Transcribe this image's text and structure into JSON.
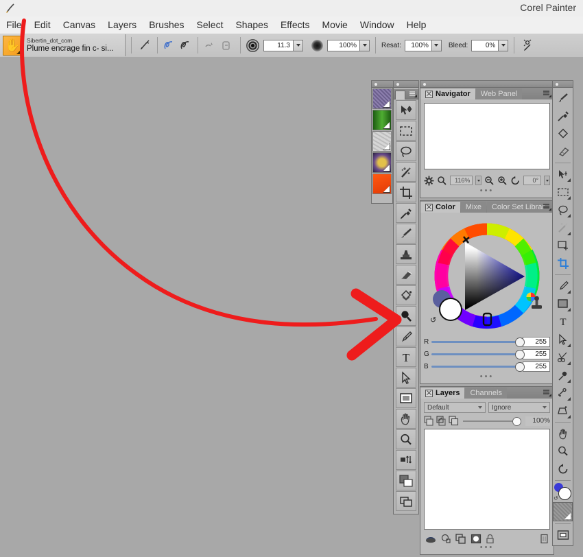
{
  "window": {
    "app_title": "Corel Painter",
    "title_icon": "brush-icon"
  },
  "menubar": {
    "items": [
      {
        "label": "File"
      },
      {
        "label": "Edit"
      },
      {
        "label": "Canvas"
      },
      {
        "label": "Layers"
      },
      {
        "label": "Brushes"
      },
      {
        "label": "Select"
      },
      {
        "label": "Shapes"
      },
      {
        "label": "Effects"
      },
      {
        "label": "Movie"
      },
      {
        "label": "Window"
      },
      {
        "label": "Help"
      }
    ]
  },
  "property_bar": {
    "brush_selector": {
      "category": "Sibertin_dot_com",
      "variant": "Plume encrage fin c- si...",
      "icon": "hand-brush-icon"
    },
    "buttons": [
      {
        "name": "brush-control-icon",
        "glyph": "brush-ctrl"
      },
      {
        "name": "freehand-stroke-icon",
        "glyph": "squiggle-blue"
      },
      {
        "name": "straight-line-stroke-icon",
        "glyph": "squiggle-dark"
      },
      {
        "name": "record-stroke-icon",
        "glyph": "record"
      },
      {
        "name": "playback-stroke-icon",
        "glyph": "playback"
      }
    ],
    "size": {
      "label": "",
      "value": "11.3"
    },
    "opacity": {
      "label": "",
      "value": "100%"
    },
    "resat": {
      "label": "Resat:",
      "value": "100%"
    },
    "bleed": {
      "label": "Bleed:",
      "value": "0%"
    },
    "end_button": {
      "name": "brush-creator-icon"
    }
  },
  "materials": {
    "swatches": [
      {
        "name": "paper-swatch",
        "color": "#7c6f9a"
      },
      {
        "name": "gradient-swatch",
        "color": "#2f7d1f"
      },
      {
        "name": "pattern-swatch",
        "color": "#c9c9c9"
      },
      {
        "name": "weave-swatch",
        "color": "#8b6f2a"
      },
      {
        "name": "nozzle-swatch",
        "color": "#f24b12"
      }
    ]
  },
  "toolbox": {
    "tools": [
      {
        "name": "layer-adjuster-tool",
        "label": "Layer Adjuster"
      },
      {
        "name": "rectangular-selection-tool",
        "label": "Rectangular Selection"
      },
      {
        "name": "lasso-tool",
        "label": "Lasso"
      },
      {
        "name": "magic-wand-tool",
        "label": "Magic Wand"
      },
      {
        "name": "crop-tool",
        "label": "Crop"
      },
      {
        "name": "dropper-tool",
        "label": "Dropper"
      },
      {
        "name": "brush-tool",
        "label": "Brush"
      },
      {
        "name": "rubber-stamp-tool",
        "label": "Rubber Stamp"
      },
      {
        "name": "eraser-tool",
        "label": "Eraser"
      },
      {
        "name": "paint-bucket-tool",
        "label": "Paint Bucket"
      },
      {
        "name": "magnifier-dark-tool",
        "label": "Magnifier"
      },
      {
        "name": "pen-tool",
        "label": "Pen"
      },
      {
        "name": "text-tool",
        "label": "Text"
      },
      {
        "name": "shape-selection-tool",
        "label": "Shape Selection"
      },
      {
        "name": "rectangular-shape-tool",
        "label": "Rectangular Shape"
      },
      {
        "name": "grabber-tool",
        "label": "Grabber"
      },
      {
        "name": "magnifier-tool",
        "label": "Magnifier"
      },
      {
        "name": "transform-tool",
        "label": "Transform"
      },
      {
        "name": "color-swatch-tool",
        "label": "Color Swatches"
      },
      {
        "name": "layers-toggle-tool",
        "label": "Layers"
      }
    ]
  },
  "navigator_panel": {
    "tabs": [
      {
        "label": "Navigator",
        "active": true
      },
      {
        "label": "Web Panel",
        "active": false
      }
    ],
    "zoom": "116%",
    "rotation": "0°",
    "buttons": [
      {
        "name": "navigator-settings-icon"
      },
      {
        "name": "navigator-pan-icon"
      },
      {
        "name": "zoom-out-icon"
      },
      {
        "name": "zoom-in-icon"
      },
      {
        "name": "reset-rotation-icon"
      }
    ]
  },
  "color_panel": {
    "tabs": [
      {
        "label": "Color",
        "active": true
      },
      {
        "label": "Mixe",
        "active": false
      },
      {
        "label": "Color Set Librar",
        "active": false
      }
    ],
    "primary_color": "#ffffff",
    "secondary_color": "#5a5f9e",
    "hue_marker_color": "#e02020",
    "value_marker_color": "#1a1aee",
    "sliders": [
      {
        "label": "R",
        "value": "255"
      },
      {
        "label": "G",
        "value": "255"
      },
      {
        "label": "B",
        "value": "255"
      }
    ],
    "clone_color_icon": "clone-color-icon",
    "rubber-stamp_icon": "color-stamp-icon"
  },
  "layers_panel": {
    "tabs": [
      {
        "label": "Layers",
        "active": true
      },
      {
        "label": "Channels",
        "active": false
      }
    ],
    "composite_method": "Default",
    "composite_depth": "Ignore",
    "opacity": "100%",
    "toggles": [
      {
        "name": "preserve-transparency-icon"
      },
      {
        "name": "pick-up-underlying-color-icon"
      },
      {
        "name": "layer-mask-icon"
      }
    ],
    "bottom_buttons": [
      {
        "name": "dynamic-plugins-icon"
      },
      {
        "name": "new-layer-mask-icon"
      },
      {
        "name": "new-layer-icon"
      },
      {
        "name": "new-watercolor-layer-icon"
      },
      {
        "name": "lock-layer-icon"
      },
      {
        "name": "delete-layer-icon"
      }
    ]
  },
  "right_toolbar": {
    "buttons": [
      {
        "name": "brush-tool-icon"
      },
      {
        "name": "dropper-tool-icon"
      },
      {
        "name": "paint-bucket-tool-icon"
      },
      {
        "name": "eraser-tool-icon"
      },
      {
        "name": "layer-adjuster-icon"
      },
      {
        "name": "rectangular-selection-icon"
      },
      {
        "name": "lasso-selection-icon"
      },
      {
        "name": "magic-wand-icon"
      },
      {
        "name": "selection-adjuster-icon"
      },
      {
        "name": "crop-icon",
        "active": true
      },
      {
        "name": "pen-icon"
      },
      {
        "name": "rectangular-shape-icon"
      },
      {
        "name": "text-icon"
      },
      {
        "name": "shape-selection-icon"
      },
      {
        "name": "scissors-icon"
      },
      {
        "name": "shape-add-point-icon"
      },
      {
        "name": "shape-convert-point-icon"
      },
      {
        "name": "perspective-grid-icon"
      },
      {
        "name": "grabber-icon"
      },
      {
        "name": "magnifier-icon"
      },
      {
        "name": "rotate-page-icon"
      },
      {
        "name": "color-swatch-icon"
      },
      {
        "name": "paper-texture-icon"
      },
      {
        "name": "screen-mode-icon"
      }
    ]
  },
  "annotation": {
    "arrow_color": "#ee1c1c",
    "description": "red-curved-arrow"
  }
}
